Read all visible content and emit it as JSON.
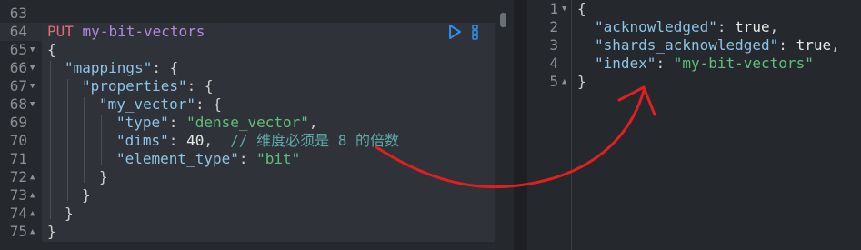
{
  "request_editor": {
    "line_numbers": [
      "63",
      "64",
      "65",
      "66",
      "67",
      "68",
      "69",
      "70",
      "71",
      "72",
      "73",
      "74",
      "75"
    ],
    "method": "PUT",
    "path": "my-bit-vectors",
    "lines": {
      "l65": "{",
      "l66_key": "\"mappings\"",
      "l66_rest": ": {",
      "l67_key": "\"properties\"",
      "l67_rest": ": {",
      "l68_key": "\"my_vector\"",
      "l68_rest": ": {",
      "l69_key": "\"type\"",
      "l69_colon": ": ",
      "l69_val": "\"dense_vector\"",
      "l69_end": ",",
      "l70_key": "\"dims\"",
      "l70_colon": ": ",
      "l70_val": "40",
      "l70_end": ",  ",
      "l70_comment": "// 维度必须是 8 的倍数",
      "l71_key": "\"element_type\"",
      "l71_colon": ": ",
      "l71_val": "\"bit\"",
      "l72": "}",
      "l73": "}",
      "l74": "}",
      "l75": "}"
    }
  },
  "response_viewer": {
    "line_numbers": [
      "1",
      "2",
      "3",
      "4",
      "5"
    ],
    "lines": {
      "l1": "{",
      "l2_key": "\"acknowledged\"",
      "l2_colon": ": ",
      "l2_val": "true",
      "l2_end": ",",
      "l3_key": "\"shards_acknowledged\"",
      "l3_colon": ": ",
      "l3_val": "true",
      "l3_end": ",",
      "l4_key": "\"index\"",
      "l4_colon": ": ",
      "l4_val": "\"my-bit-vectors\"",
      "l5": "}"
    }
  },
  "icons": {
    "run": "play-icon",
    "wrench": "settings-menu-icon",
    "annotation": "red-arrow-annotation"
  },
  "colors": {
    "background": "#25282c",
    "request_bg": "#2f3238",
    "method": "#e06c75",
    "path": "#b089e0",
    "key": "#8cc4e8",
    "string": "#5fc07a",
    "comment": "#5fa8a8",
    "arrow": "#e02020",
    "run_icon": "#2f8fe6"
  }
}
